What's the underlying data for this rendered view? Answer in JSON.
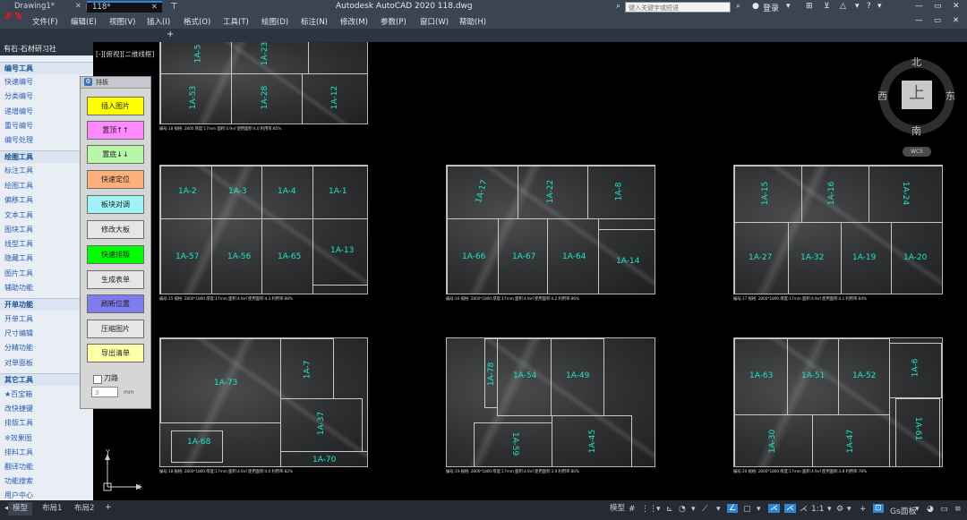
{
  "app": {
    "title": "Autodesk AutoCAD 2020    118.dwg",
    "search_placeholder": "键入关键字或短语",
    "login": "登录"
  },
  "menu": [
    "文件(F)",
    "编辑(E)",
    "视图(V)",
    "插入(I)",
    "格式(O)",
    "工具(T)",
    "绘图(D)",
    "标注(N)",
    "修改(M)",
    "参数(P)",
    "窗口(W)",
    "帮助(H)"
  ],
  "tabs": [
    {
      "label": "Drawing1*"
    },
    {
      "label": "118*"
    }
  ],
  "left_panel": {
    "title": "有石-石材研习社",
    "sections": [
      {
        "name": "编号工具",
        "items": [
          "快速编号",
          "分类编号",
          "递增编号",
          "重号编号",
          "编号处理"
        ]
      },
      {
        "name": "绘图工具",
        "items": [
          "标注工具",
          "绘图工具",
          "偏移工具",
          "文本工具",
          "图块工具",
          "线型工具",
          "隐藏工具",
          "图片工具",
          "辅助功能"
        ]
      },
      {
        "name": "开单功能",
        "items": [
          "开单工具",
          "尺寸编辑",
          "分精功能",
          "对单面板"
        ]
      },
      {
        "name": "其它工具",
        "items": [
          "★百宝箱",
          "改快捷键",
          "排版工具",
          "※效果图",
          "排料工具",
          "翻译功能",
          "功能搜索",
          "用户中心"
        ]
      }
    ]
  },
  "tool_panel": {
    "title": "排板",
    "buttons": [
      {
        "label": "插入图片",
        "color": "#ffff00"
      },
      {
        "label": "置顶↑↑",
        "color": "#ff88ff"
      },
      {
        "label": "置底↓↓",
        "color": "#b6f7a8"
      },
      {
        "label": "快速定位",
        "color": "#ffb07a"
      },
      {
        "label": "板块对调",
        "color": "#9ff3f6"
      },
      {
        "label": "修改大板",
        "color": "#e6e6e6"
      },
      {
        "label": "快速排版",
        "color": "#00ff00"
      },
      {
        "label": "生成表单",
        "color": "#e6e6e6"
      },
      {
        "label": "刷新位置",
        "color": "#7d7df0"
      },
      {
        "label": "压缩图片",
        "color": "#e6e6e6"
      },
      {
        "label": "导出清单",
        "color": "#ffffa8"
      }
    ],
    "checkbox_label": "刀路",
    "input_value": "3",
    "unit": "mm"
  },
  "view_label": "[-][俯视][二维线框]",
  "viewcube": {
    "north": "北",
    "south": "南",
    "east": "东",
    "west": "西",
    "top": "上",
    "wcs": "WCS"
  },
  "slabs": [
    {
      "id": "s0",
      "labels": [
        "1A-53",
        "1A-23",
        "1A-28",
        "1A-12",
        "1A-5"
      ],
      "note": "编号:18  规格: 2800   厚度:17mm 面积:4.9㎡ 使用面积:4.0 利用率:85%"
    },
    {
      "id": "s1",
      "labels": [
        "1A-2",
        "1A-3",
        "1A-4",
        "1A-1",
        "1A-57",
        "1A-56",
        "1A-65",
        "1A-13"
      ],
      "note": "编号:15  规格: 2800*1800  厚度:17mm 面积:4.9㎡ 使用面积:4.3 利用率:88%"
    },
    {
      "id": "s2",
      "labels": [
        "1A-17",
        "1A-22",
        "1A-8",
        "1A-66",
        "1A-67",
        "1A-64",
        "1A-14"
      ],
      "note": "编号:16  规格: 2800*1800  厚度:17mm 面积:4.9㎡ 使用面积:4.2 利用率:86%"
    },
    {
      "id": "s3",
      "labels": [
        "1A-15",
        "1A-16",
        "1A-24",
        "1A-27",
        "1A-32",
        "1A-19",
        "1A-20"
      ],
      "note": "编号:17  规格: 2800*1800  厚度:17mm 面积:4.9㎡ 使用面积:4.1 利用率:84%"
    },
    {
      "id": "s4",
      "labels": [
        "1A-73",
        "1A-7",
        "1A-68",
        "1A-37",
        "1A-70"
      ],
      "note": "编号:18  规格: 2800*1800  厚度:17mm 面积:4.9㎡ 使用面积:4.0 利用率:82%"
    },
    {
      "id": "s5",
      "labels": [
        "1A-78",
        "1A-54",
        "1A-49",
        "1A-59",
        "1A-45"
      ],
      "note": "编号:19  规格: 2800*1800  厚度:17mm 面积:4.9㎡ 使用面积:3.9 利用率:80%"
    },
    {
      "id": "s6",
      "labels": [
        "1A-63",
        "1A-51",
        "1A-52",
        "1A-6",
        "1A-30",
        "1A-47",
        "1A-61"
      ],
      "note": "编号:20  规格: 2800*1800  厚度:17mm 面积:4.9㎡ 使用面积:3.8 利用率:78%"
    }
  ],
  "status": {
    "tabs": [
      "模型",
      "布局1",
      "布局2"
    ],
    "scale": "1:1",
    "workspace": "Gs面板"
  }
}
